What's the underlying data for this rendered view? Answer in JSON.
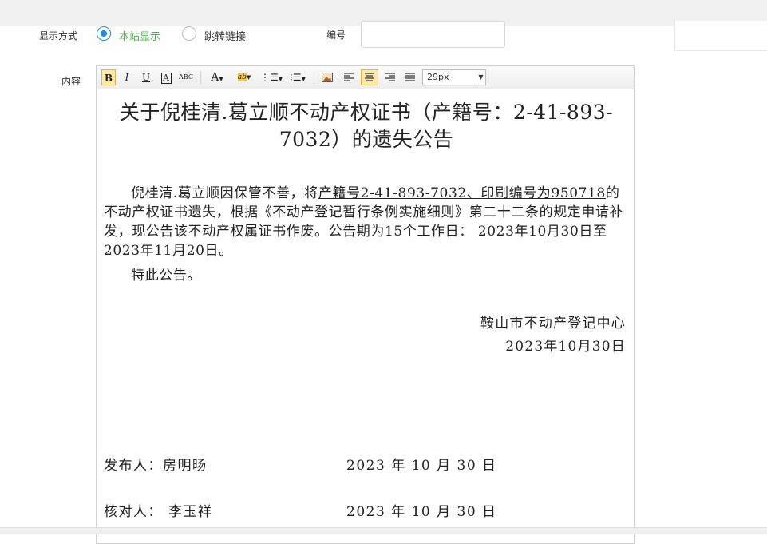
{
  "form": {
    "display_mode_label": "显示方式",
    "display_options": [
      "本站显示",
      "跳转链接"
    ],
    "selected_option": "本站显示",
    "number_label": "编号",
    "number_value": "",
    "content_label": "内容"
  },
  "toolbar": {
    "bold": "B",
    "italic": "I",
    "underline": "U",
    "border": "A",
    "strike": "ABC",
    "fontcolor": "A",
    "highlight": "ab",
    "font_size": "29px"
  },
  "document": {
    "title": "关于倪桂清.葛立顺不动产权证书（产籍号：2-41-893-7032）的遗失公告",
    "para1_start": "倪桂清.葛立顺因保管不善，将",
    "para1_underline": "产籍号2-41-893-7032、印刷编号为950718",
    "para1_end": "的不动产权证书遗失，根据《不动产登记暂行条例实施细则》第二十二条的规定申请补发，现公告该不动产权属证书作废。公告期为15个工作日：  2023年10月30日至2023年11月20日。",
    "para2": "特此公告。",
    "org": "鞍山市不动产登记中心",
    "org_date": "2023年10月30日",
    "publisher": "发布人：房明旸",
    "publisher_date": "2023 年 10  月 30 日",
    "checker": "核对人：  李玉祥",
    "checker_date": "2023 年  10 月 30  日"
  }
}
